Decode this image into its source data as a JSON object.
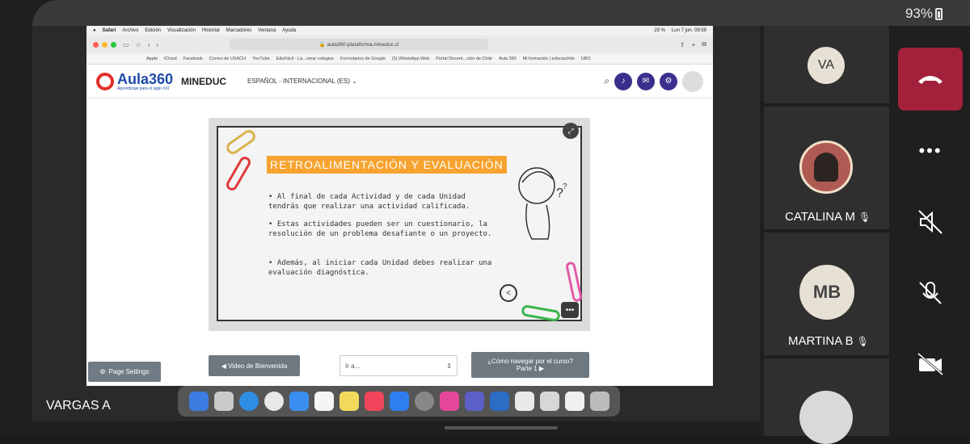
{
  "device": {
    "battery": "93%"
  },
  "presenter": {
    "name": "VARGAS A"
  },
  "mac": {
    "menubar": [
      "Safari",
      "Archivo",
      "Edición",
      "Visualización",
      "Historial",
      "Marcadores",
      "Ventana",
      "Ayuda"
    ],
    "menubar_right": {
      "battery": "29 %",
      "datetime": "Lun 7 jun.  09:59"
    },
    "url": "aula360-plataforma.mineduc.cl",
    "favorites": [
      "Apple",
      "iCloud",
      "Facebook",
      "Correo de USACH",
      "YouTube",
      "EduFácil - La...omar colegios",
      "Formularios de Google",
      "(5) WhatsApp Web",
      "Portal Docent...ción de Chile",
      "Aula 360",
      "Mi formación | educarchile",
      "UBO"
    ]
  },
  "site": {
    "logo_main": "Aula360",
    "logo_sub": "Aprendizaje para el siglo XXI",
    "brand": "MINEDUC",
    "language": "ESPAÑOL - INTERNACIONAL (ES)"
  },
  "slide": {
    "title": "RETROALIMENTACIÓN Y EVALUACIÓN",
    "bullets": [
      "Al final de cada Actividad y de cada Unidad tendrás que realizar una actividad calificada.",
      "Estas actividades pueden ser un cuestionario, la resolución de un problema desafiante o un proyecto.",
      "Además, al iniciar cada Unidad debes realizar una evaluación diagnóstica."
    ]
  },
  "nav": {
    "page_settings": "Page Settings",
    "prev": "Video de Bienvenida",
    "goto": "Ir a...",
    "next_line1": "¿Cómo navegar por el curso?",
    "next_line2": "Parte 1 ▶"
  },
  "participants": [
    {
      "initials": "VA",
      "name": ""
    },
    {
      "initials": "",
      "name": "CATALINA M"
    },
    {
      "initials": "MB",
      "name": "MARTINA B"
    }
  ],
  "colors": {
    "end_call": "#a3213a",
    "accent_orange": "#f7a330",
    "mineduc_purple": "#3b2f8e"
  }
}
